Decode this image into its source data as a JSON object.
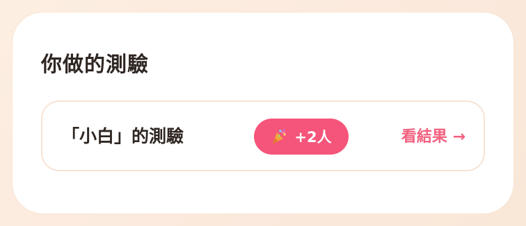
{
  "section": {
    "title": "你做的測驗"
  },
  "quiz_item": {
    "name": "「小白」的測驗",
    "badge": {
      "icon": "party-popper-icon",
      "text": "+2人",
      "color": "#f5557a"
    },
    "result_link": "看結果 →",
    "link_color": "#f2607f"
  }
}
